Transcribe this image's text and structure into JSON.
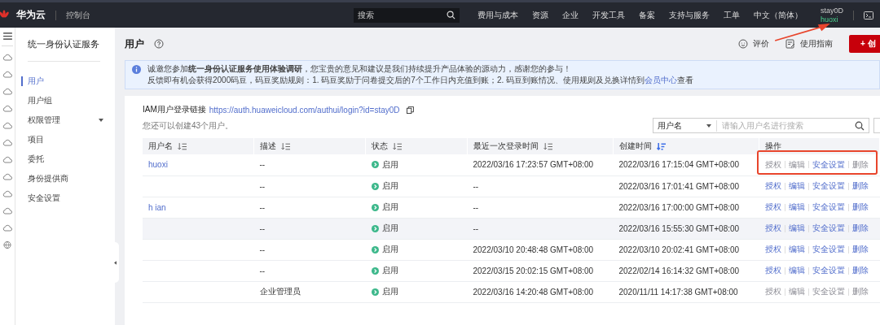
{
  "topbar": {
    "brand": "华为云",
    "console": "控制台",
    "search": {
      "placeholder": "搜索"
    },
    "menu": [
      "费用与成本",
      "资源",
      "企业",
      "开发工具",
      "备案",
      "支持与服务",
      "工单",
      "中文（简体）"
    ],
    "account": "stay0D",
    "user": "huoxi"
  },
  "rail_icons": [
    {
      "kind": "cloud"
    },
    {
      "kind": "cloud"
    },
    {
      "kind": "cloud"
    },
    {
      "kind": "cloud"
    },
    {
      "kind": "cloud"
    },
    {
      "kind": "cloud"
    },
    {
      "kind": "cloud"
    },
    {
      "kind": "cloud"
    },
    {
      "kind": "cloud"
    },
    {
      "kind": "cloud"
    },
    {
      "kind": "cloud"
    },
    {
      "kind": "globe"
    }
  ],
  "sidebar": {
    "title": "统一身份认证服务",
    "items": [
      {
        "label": "用户",
        "selected": true,
        "expandable": false
      },
      {
        "label": "用户组",
        "selected": false,
        "expandable": false
      },
      {
        "label": "权限管理",
        "selected": false,
        "expandable": true
      },
      {
        "label": "项目",
        "selected": false,
        "expandable": false
      },
      {
        "label": "委托",
        "selected": false,
        "expandable": false
      },
      {
        "label": "身份提供商",
        "selected": false,
        "expandable": false
      },
      {
        "label": "安全设置",
        "selected": false,
        "expandable": false
      }
    ]
  },
  "page": {
    "title": "用户",
    "feedback": "评价",
    "guide": "使用指南",
    "create": "+ 创"
  },
  "notice": {
    "line1": "诚邀您参加**统一身份认证服务使用体验调研**，您宝贵的意见和建议是我们持续提升产品体验的源动力，感谢您的参与！",
    "line2_pre": "反馈即有机会获得2000码豆，码豆奖励规则：1. 码豆奖励于问卷提交后的7个工作日内充值到账；2. 码豆到账情况、使用规则及兑换详情到",
    "line2_link": "会员中心",
    "line2_post": "查看"
  },
  "login_link": {
    "label": "IAM用户登录链接",
    "url": "https://auth.huaweicloud.com/authui/login?id=stay0D"
  },
  "quota": "您还可以创建43个用户。",
  "filter": {
    "field": "用户名",
    "placeholder": "请输入用户名进行搜索"
  },
  "table": {
    "columns": [
      {
        "label": "用户名",
        "sortable": true,
        "sorted": false
      },
      {
        "label": "描述",
        "sortable": true,
        "sorted": false
      },
      {
        "label": "状态",
        "sortable": true,
        "sorted": false
      },
      {
        "label": "最近一次登录时间",
        "sortable": true,
        "sorted": false
      },
      {
        "label": "创建时间",
        "sortable": true,
        "sorted": true
      },
      {
        "label": "操作",
        "sortable": false
      }
    ],
    "rows": [
      {
        "name": "huoxi",
        "desc": "--",
        "status": "启用",
        "last": "2022/03/16 17:23:57 GMT+08:00",
        "created": "2022/03/16 17:15:04 GMT+08:00",
        "hovered": false,
        "highlighted": true,
        "actions": [
          {
            "label": "授权",
            "disabled": true
          },
          {
            "label": "编辑",
            "disabled": true
          },
          {
            "label": "安全设置",
            "disabled": false
          },
          {
            "label": "删除",
            "disabled": true
          }
        ]
      },
      {
        "desc": "--",
        "status": "启用",
        "last": "--",
        "created": "2022/03/16 17:01:41 GMT+08:00",
        "hovered": false,
        "highlighted": false,
        "actions": [
          {
            "label": "授权",
            "disabled": false
          },
          {
            "label": "编辑",
            "disabled": false
          },
          {
            "label": "安全设置",
            "disabled": false
          },
          {
            "label": "删除",
            "disabled": false
          }
        ]
      },
      {
        "name": "h ian",
        "desc": "--",
        "status": "启用",
        "last": "--",
        "created": "2022/03/16 17:00:00 GMT+08:00",
        "hovered": false,
        "highlighted": false,
        "actions": [
          {
            "label": "授权",
            "disabled": false
          },
          {
            "label": "编辑",
            "disabled": false
          },
          {
            "label": "安全设置",
            "disabled": false
          },
          {
            "label": "删除",
            "disabled": false
          }
        ]
      },
      {
        "desc": "--",
        "status": "启用",
        "last": "--",
        "created": "2022/03/16 15:55:30 GMT+08:00",
        "hovered": true,
        "highlighted": false,
        "actions": [
          {
            "label": "授权",
            "disabled": false
          },
          {
            "label": "编辑",
            "disabled": false
          },
          {
            "label": "安全设置",
            "disabled": false
          },
          {
            "label": "删除",
            "disabled": false
          }
        ]
      },
      {
        "desc": "--",
        "status": "启用",
        "last": "2022/03/10 20:48:48 GMT+08:00",
        "created": "2022/03/10 20:02:41 GMT+08:00",
        "hovered": false,
        "highlighted": false,
        "actions": [
          {
            "label": "授权",
            "disabled": false
          },
          {
            "label": "编辑",
            "disabled": false
          },
          {
            "label": "安全设置",
            "disabled": false
          },
          {
            "label": "删除",
            "disabled": false
          }
        ]
      },
      {
        "desc": "--",
        "status": "启用",
        "last": "2022/03/15 20:02:15 GMT+08:00",
        "created": "2022/02/14 16:14:32 GMT+08:00",
        "hovered": false,
        "highlighted": false,
        "actions": [
          {
            "label": "授权",
            "disabled": false
          },
          {
            "label": "编辑",
            "disabled": false
          },
          {
            "label": "安全设置",
            "disabled": false
          },
          {
            "label": "删除",
            "disabled": false
          }
        ]
      },
      {
        "desc": "企业管理员",
        "status": "启用",
        "last": "2022/03/16 14:20:48 GMT+08:00",
        "created": "2020/11/11 14:17:38 GMT+08:00",
        "hovered": false,
        "highlighted": false,
        "actions": [
          {
            "label": "授权",
            "disabled": true
          },
          {
            "label": "编辑",
            "disabled": true
          },
          {
            "label": "安全设置",
            "disabled": true
          },
          {
            "label": "删除",
            "disabled": true
          }
        ]
      }
    ]
  },
  "pointer_arrow": true
}
